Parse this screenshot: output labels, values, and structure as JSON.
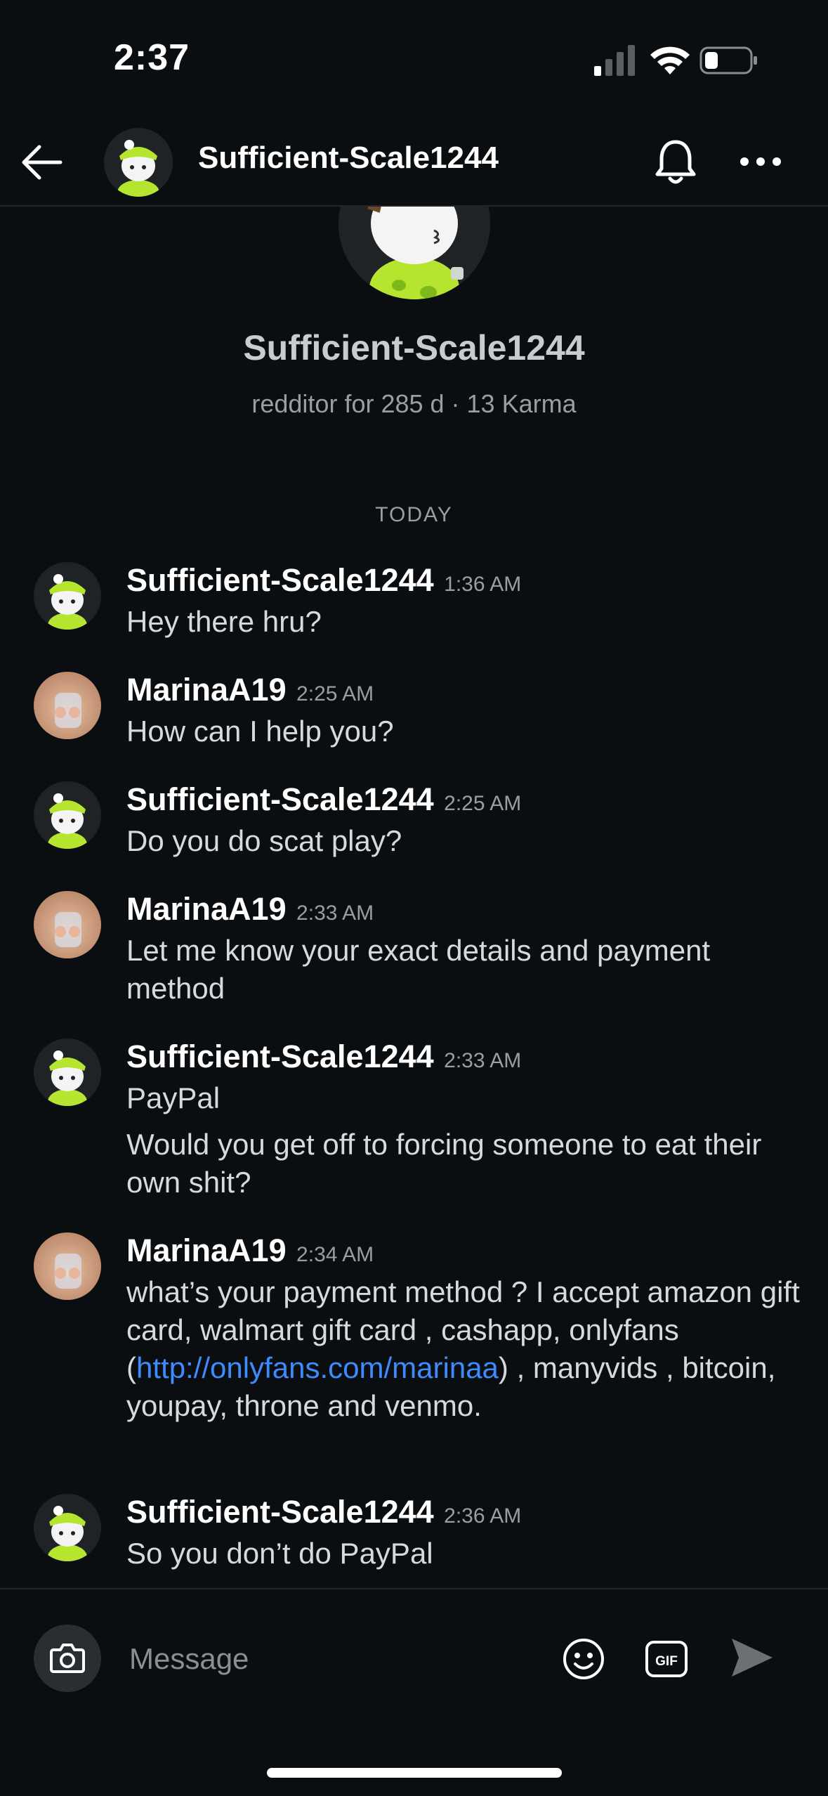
{
  "status_bar": {
    "time": "2:37"
  },
  "header": {
    "title": "Sufficient-Scale1244",
    "back_icon": "arrow-left-icon",
    "notify_icon": "bell-icon",
    "more_icon": "more-horizontal-icon"
  },
  "profile": {
    "name": "Sufficient-Scale1244",
    "meta": "redditor for 285 d · 13 Karma"
  },
  "day_label": "TODAY",
  "messages": [
    {
      "user": "Sufficient-Scale1244",
      "time": "1:36 AM",
      "lines": [
        "Hey there hru?"
      ]
    },
    {
      "user": "MarinaA19",
      "time": "2:25 AM",
      "lines": [
        "How can I help you?"
      ]
    },
    {
      "user": "Sufficient-Scale1244",
      "time": "2:25 AM",
      "lines": [
        "Do you do scat play?"
      ]
    },
    {
      "user": "MarinaA19",
      "time": "2:33 AM",
      "lines": [
        "Let me know your exact details and payment method"
      ]
    },
    {
      "user": "Sufficient-Scale1244",
      "time": "2:33 AM",
      "lines": [
        "PayPal",
        "Would you get off to forcing someone to eat their own shit?"
      ]
    },
    {
      "user": "MarinaA19",
      "time": "2:34 AM",
      "lines": [
        "what’s your  payment method ? I accept amazon gift card, walmart gift card , cashapp, onlyfans (",
        ")  , manyvids , bitcoin, youpay, throne and venmo."
      ],
      "link": "http://onlyfans.com/marinaa"
    },
    {
      "user": "Sufficient-Scale1244",
      "time": "2:36 AM",
      "lines": [
        "So you don’t do PayPal"
      ]
    }
  ],
  "composer": {
    "placeholder": "Message",
    "camera_icon": "camera-icon",
    "emoji_icon": "emoji-icon",
    "gif_label": "GIF",
    "send_icon": "send-icon"
  },
  "colors": {
    "background": "#0b0e11",
    "link": "#3d8bfd",
    "avatar_green": "#b5e52f"
  }
}
